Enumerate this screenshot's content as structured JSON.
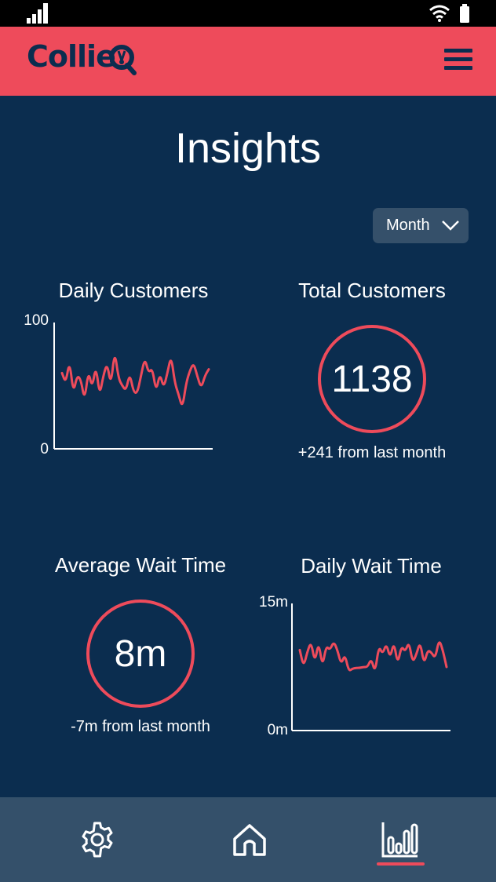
{
  "header": {
    "logo_text": "Collie",
    "menu_icon": "hamburger-menu-icon"
  },
  "page": {
    "title": "Insights"
  },
  "filter": {
    "period_value": "Month",
    "icon": "chevron-down-icon"
  },
  "cards": {
    "daily_customers": {
      "title": "Daily Customers"
    },
    "total_customers": {
      "title": "Total Customers",
      "value": "1138",
      "delta": "+241 from last month"
    },
    "average_wait_time": {
      "title": "Average Wait Time",
      "value": "8m",
      "delta": "-7m from last month"
    },
    "daily_wait_time": {
      "title": "Daily Wait Time"
    }
  },
  "chart_data": [
    {
      "type": "line",
      "title": "Daily Customers",
      "ylim": [
        0,
        100
      ],
      "y_tick_labels": [
        "0",
        "100"
      ],
      "grid": false,
      "legend": "none",
      "series_color": "#ee4b5b",
      "values": [
        60,
        52,
        70,
        44,
        58,
        55,
        38,
        62,
        48,
        66,
        42,
        58,
        68,
        50,
        78,
        56,
        50,
        46,
        60,
        45,
        44,
        58,
        72,
        60,
        64,
        45,
        60,
        48,
        60,
        74,
        52,
        43,
        32,
        52,
        62,
        68,
        57,
        48,
        58,
        63
      ]
    },
    {
      "type": "line",
      "title": "Daily Wait Time",
      "ylim": [
        0,
        15
      ],
      "y_tick_labels": [
        "0m",
        "15m"
      ],
      "grid": false,
      "legend": "none",
      "series_color": "#ee4b5b",
      "values": [
        9.5,
        7.5,
        9.3,
        10.5,
        8.0,
        10.5,
        7.5,
        10.0,
        9.5,
        10.5,
        9.5,
        7.8,
        9.0,
        7.0,
        7.3,
        7.4,
        7.4,
        7.5,
        7.5,
        8.5,
        6.8,
        10.0,
        9.0,
        10.3,
        8.5,
        10.5,
        7.8,
        10.0,
        9.3,
        10.5,
        8.0,
        9.0,
        10.5,
        7.8,
        9.5,
        9.2,
        8.5,
        10.8,
        9.5,
        7.5
      ]
    }
  ],
  "nav": {
    "settings_icon": "gear-icon",
    "home_icon": "home-icon",
    "insights_icon": "bar-chart-icon"
  },
  "colors": {
    "brand": "#ee4b5b",
    "background": "#0b2d4f",
    "nav_background": "#34506a"
  }
}
